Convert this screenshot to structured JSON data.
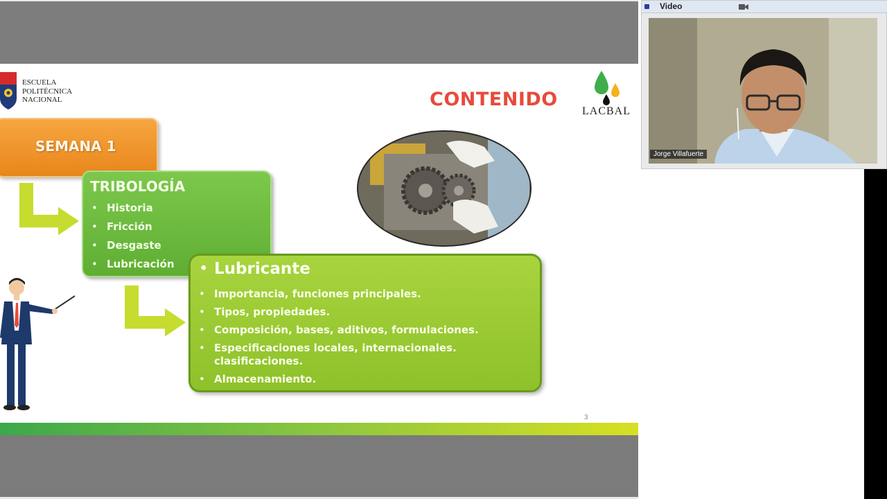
{
  "slide": {
    "institution": [
      "ESCUELA",
      "POLITÉCNICA",
      "NACIONAL"
    ],
    "title": "CONTENIDO",
    "brand": "LACBAL",
    "week_label": "SEMANA 1",
    "tribologia": {
      "heading": "TRIBOLOGÍA",
      "items": [
        "Historia",
        "Fricción",
        "Desgaste",
        "Lubricación"
      ]
    },
    "lubricante": {
      "heading": "Lubricante",
      "items": [
        "Importancia, funciones principales.",
        "Tipos, propiedades.",
        "Composición, bases, aditivos, formulaciones.",
        "Especificaciones locales, internacionales. clasificaciones.",
        "Almacenamiento."
      ]
    },
    "page_number": "3"
  },
  "video_panel": {
    "title": "Video",
    "participant_name": "Jorge Villafuerte"
  },
  "colors": {
    "title_red": "#e84a3c",
    "orange_box": "#f29a30",
    "green_box": "#6bbb3f",
    "lime_box": "#9acb33",
    "arrow": "#c6dc2e"
  }
}
